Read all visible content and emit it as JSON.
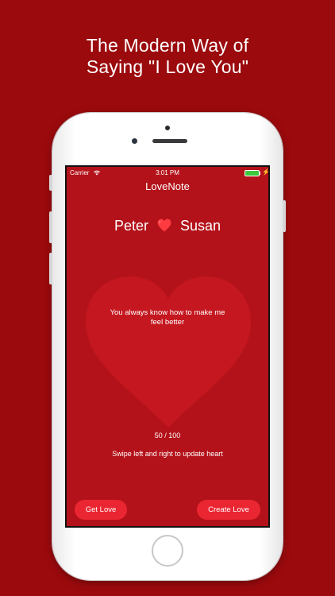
{
  "headline": {
    "line1": "The Modern Way of",
    "line2": "Saying \"I Love You\""
  },
  "status_bar": {
    "carrier": "Carrier",
    "time": "3:01 PM",
    "battery_color": "#3ec63d"
  },
  "app": {
    "title": "LoveNote",
    "partner_left": "Peter",
    "partner_right": "Susan",
    "message": "You always know how to make me feel better",
    "score": "50 / 100",
    "hint": "Swipe left and right to update heart",
    "get_love_label": "Get Love",
    "create_love_label": "Create Love"
  },
  "colors": {
    "background": "#9b0a0d",
    "screen": "#b4121a",
    "heart": "#c4171f",
    "button": "#ea2632"
  },
  "icons": [
    "wifi-icon",
    "battery-icon",
    "love-heart-icon",
    "big-heart-icon"
  ]
}
